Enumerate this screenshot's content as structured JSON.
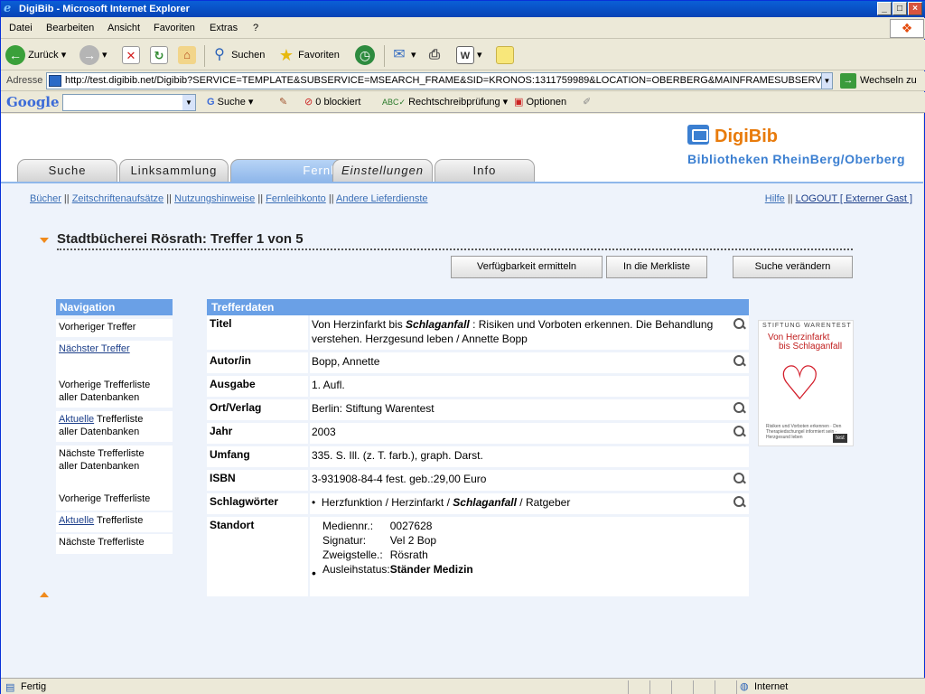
{
  "window": {
    "title": "DigiBib - Microsoft Internet Explorer"
  },
  "menu": [
    "Datei",
    "Bearbeiten",
    "Ansicht",
    "Favoriten",
    "Extras",
    "?"
  ],
  "toolbar": {
    "back": "Zurück",
    "search": "Suchen",
    "favorites": "Favoriten"
  },
  "address": {
    "label": "Adresse",
    "url": "http://test.digibib.net/Digibib?SERVICE=TEMPLATE&SUBSERVICE=MSEARCH_FRAME&SID=KRONOS:1311759989&LOCATION=OBERBERG&MAINFRAMESUBSERVICE=MSEAR",
    "go": "Wechseln zu"
  },
  "googlebar": {
    "logo": "Google",
    "search": "Suche",
    "blocked": "0 blockiert",
    "spell": "Rechtschreibprüfung",
    "options": "Optionen"
  },
  "tabs": [
    "Suche",
    "Linksammlung",
    "Fernleihe",
    "Einstellungen",
    "Info"
  ],
  "logo": {
    "name": "DigiBib",
    "subtitle": "Bibliotheken RheinBerg/Oberberg"
  },
  "sublinks": [
    "Bücher",
    "Zeitschriftenaufsätze",
    "Nutzungshinweise",
    "Fernleihkonto",
    "Andere Lieferdienste"
  ],
  "rightlinks": [
    "Hilfe",
    "LOGOUT [ Externer Gast ]"
  ],
  "heading": "Stadtbücherei Rösrath: Treffer 1 von 5",
  "buttons": [
    "Verfügbarkeit ermitteln",
    "In die Merkliste",
    "Suche verändern"
  ],
  "navigation": {
    "title": "Navigation",
    "prev": "Vorheriger Treffer",
    "next": "Nächster Treffer",
    "prev_all_1": "Vorherige Trefferliste",
    "prev_all_2": "aller Datenbanken",
    "cur_all_link": "Aktuelle",
    "cur_all_1": " Trefferliste",
    "cur_all_2": "aller Datenbanken",
    "next_all_1": "Nächste Trefferliste",
    "next_all_2": "aller Datenbanken",
    "prev_list": "Vorherige Trefferliste",
    "cur_list_link": "Aktuelle",
    "cur_list": " Trefferliste",
    "next_list": "Nächste Trefferliste"
  },
  "results": {
    "title": "Trefferdaten",
    "titel_label": "Titel",
    "titel_pre": "Von Herzinfarkt bis ",
    "titel_bold": "Schlaganfall",
    "titel_post": " : Risiken und Vorboten erkennen. Die Behandlung verstehen. Herzgesund leben / Annette Bopp",
    "autor_label": "Autor/in",
    "autor": "Bopp, Annette",
    "ausgabe_label": "Ausgabe",
    "ausgabe": "1. Aufl.",
    "ort_label": "Ort/Verlag",
    "ort": "Berlin: Stiftung Warentest",
    "jahr_label": "Jahr",
    "jahr": "2003",
    "umfang_label": "Umfang",
    "umfang": "335. S. Ill. (z. T. farb.), graph. Darst.",
    "isbn_label": "ISBN",
    "isbn": "3-931908-84-4 fest. geb.:29,00 Euro",
    "schlag_label": "Schlagwörter",
    "schlag_pre": "Herzfunktion / Herzinfarkt / ",
    "schlag_bold": "Schlaganfall",
    "schlag_post": " / Ratgeber",
    "standort_label": "Standort",
    "mednr_label": "Mediennr.:",
    "mednr": "0027628",
    "signatur_label": "Signatur:",
    "signatur": "Vel 2 Bop",
    "zweig_label": "Zweigstelle.:",
    "zweig": "Rösrath",
    "ausleih_label": "Ausleihstatus:",
    "ausleih": "Ständer Medizin"
  },
  "cover": {
    "publisher": "STIFTUNG WARENTEST",
    "title1": "Von Herzinfarkt",
    "title2": "bis Schlaganfall",
    "sub": "Risiken und Vorboten erkennen · Den Therapiedschungel informiert sein · Herzgesund leben",
    "brand": "test"
  },
  "status": {
    "text": "Fertig",
    "zone": "Internet"
  }
}
